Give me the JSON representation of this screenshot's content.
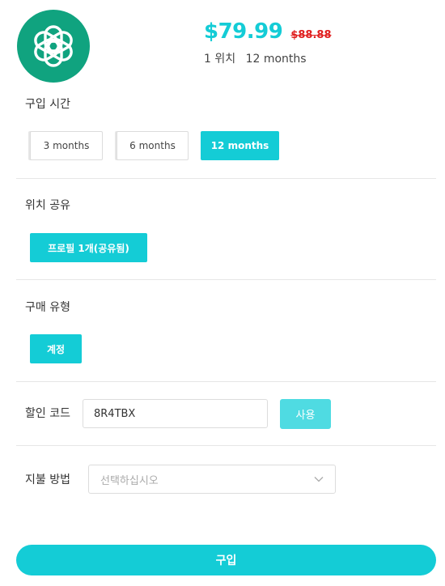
{
  "product": {
    "logo_icon": "openai-logo-icon",
    "price": "$79.99",
    "old_price": "$88.88",
    "seats": "1 위치",
    "duration": "12 months"
  },
  "duration_section": {
    "label": "구입 시간",
    "options": [
      "3 months",
      "6 months",
      "12 months"
    ],
    "selected": "12 months"
  },
  "share_section": {
    "label": "위치 공유",
    "options": [
      "프로필 1개(공유됨)"
    ],
    "selected": "프로필 1개(공유됨)"
  },
  "type_section": {
    "label": "구매 유형",
    "options": [
      "계정"
    ],
    "selected": "계정"
  },
  "coupon": {
    "label": "할인 코드",
    "value": "8R4TBX",
    "apply_label": "사용"
  },
  "payment": {
    "label": "지불 방법",
    "placeholder": "선택하십시오",
    "chevron_icon": "chevron-down-icon"
  },
  "buy_label": "구입",
  "colors": {
    "accent": "#14ccd6",
    "logo_bg": "#10a37f",
    "old_price": "#e02020",
    "apply_button": "#4fdbe2"
  }
}
